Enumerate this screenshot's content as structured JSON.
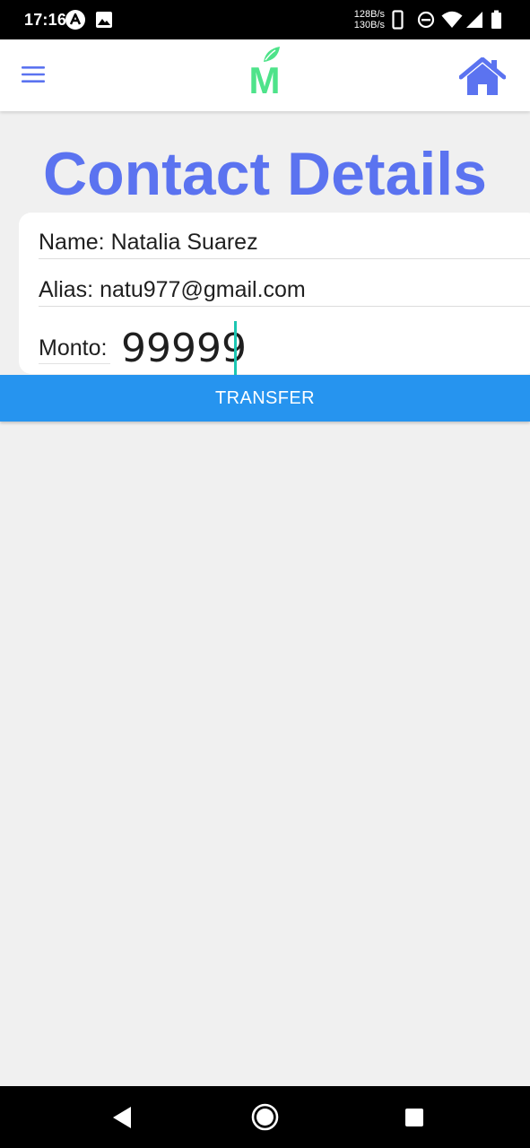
{
  "status_bar": {
    "time": "17:16",
    "net_up": "128B/s",
    "net_down": "130B/s",
    "icons": [
      "app-notification-icon",
      "image-notification-icon",
      "vibrate-icon",
      "do-not-disturb-icon",
      "wifi-icon",
      "signal-icon",
      "battery-icon"
    ]
  },
  "header": {
    "menu_icon": "hamburger-menu-icon",
    "logo_text": "M",
    "home_icon": "home-icon"
  },
  "colors": {
    "accent": "#5b73f0",
    "button": "#2694ef",
    "logo_green": "#4ee38a",
    "caret": "#1cc6b2",
    "background": "#f0f0f0"
  },
  "page": {
    "title": "Contact Details"
  },
  "details": {
    "name_label": "Name:",
    "name_value": "Natalia Suarez",
    "alias_label": "Alias:",
    "alias_value": "natu977@gmail.com",
    "amount_label": "Monto:",
    "amount_value": "99999"
  },
  "actions": {
    "transfer_label": "TRANSFER"
  },
  "nav": {
    "icons": [
      "back-icon",
      "home-circle-icon",
      "recents-icon"
    ]
  }
}
